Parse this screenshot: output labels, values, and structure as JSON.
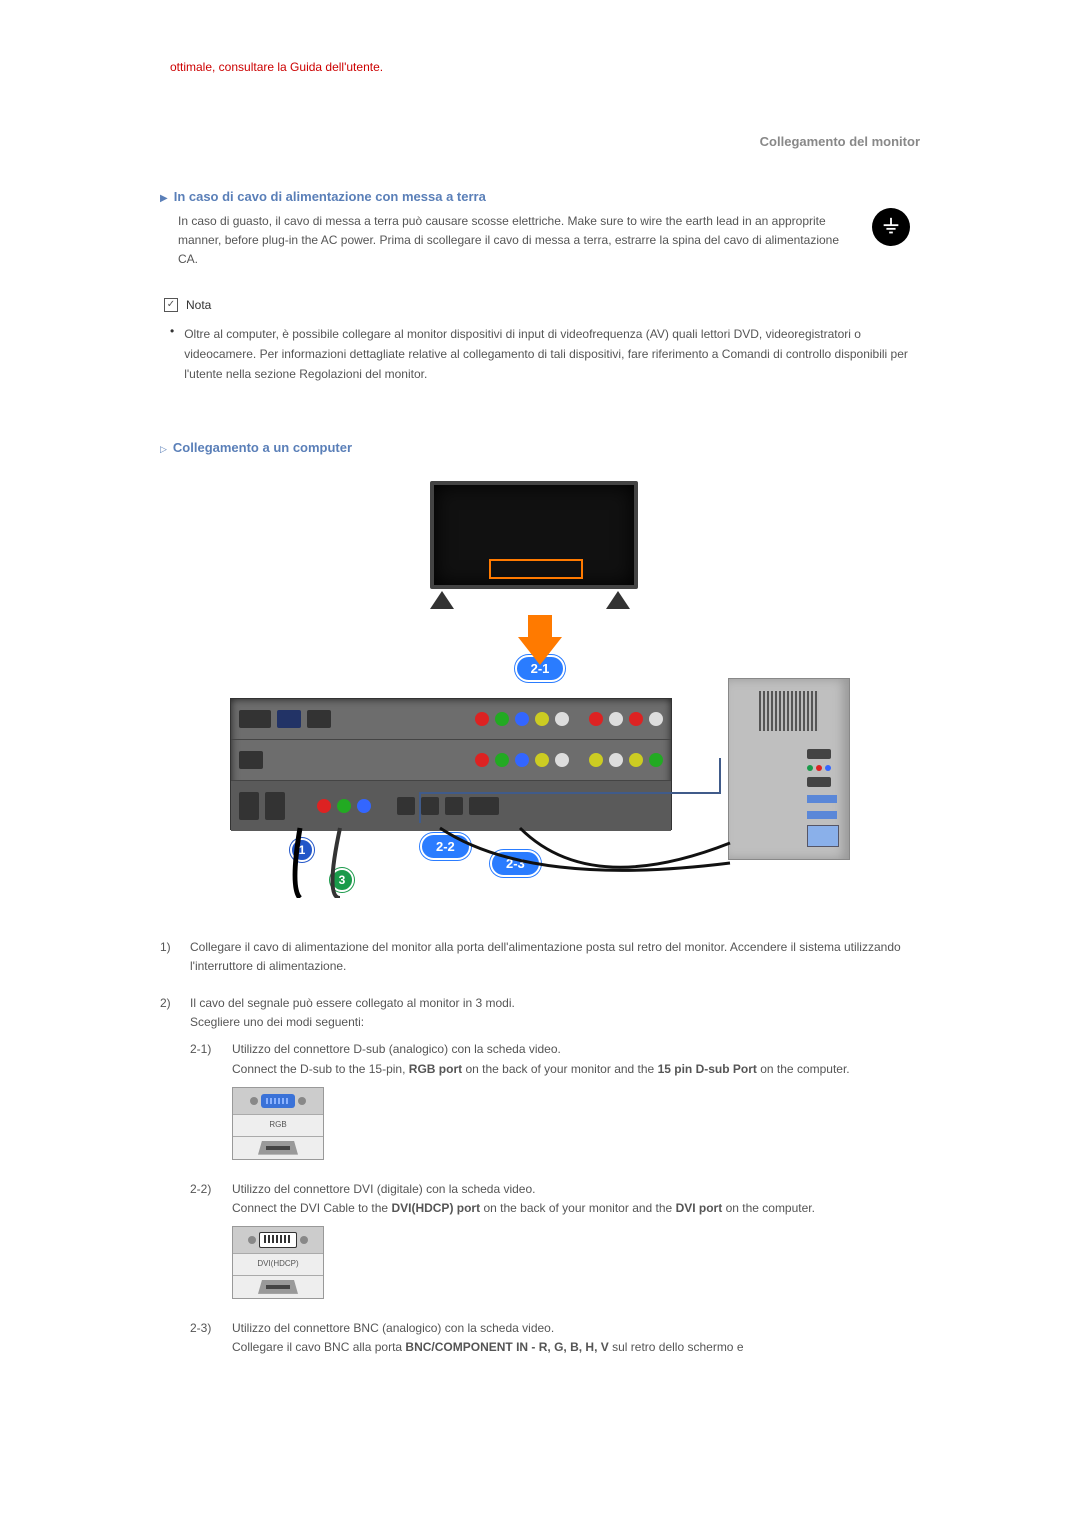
{
  "header": {
    "red_note": "ottimale, consultare la Guida dell'utente.",
    "section_title": "Collegamento del monitor"
  },
  "grounding": {
    "heading": "In caso di cavo di alimentazione con messa a terra",
    "text": "In caso di guasto, il cavo di messa a terra può causare scosse elettriche. Make sure to wire the earth lead in an approprite manner, before plug-in the AC power. Prima di scollegare il cavo di messa a terra, estrarre la spina del cavo di alimentazione CA."
  },
  "nota": {
    "label": "Nota",
    "text": "Oltre al computer, è possibile collegare al monitor dispositivi di input di videofrequenza (AV) quali lettori DVD, videoregistratori o videocamere. Per informazioni dettagliate relative al collegamento di tali dispositivi, fare riferimento a Comandi di controllo disponibili per l'utente nella sezione Regolazioni del monitor."
  },
  "connecting": {
    "heading": "Collegamento a un computer"
  },
  "diagram": {
    "callout_2_1": "2-1",
    "callout_2_2": "2-2",
    "callout_2_3": "2-3",
    "badge_1": "1",
    "badge_3": "3"
  },
  "steps": {
    "s1": {
      "num": "1)",
      "text": "Collegare il cavo di alimentazione del monitor alla porta dell'alimentazione posta sul retro del monitor. Accendere il sistema utilizzando l'interruttore di alimentazione."
    },
    "s2": {
      "num": "2)",
      "intro": "Il cavo del segnale può essere collegato al monitor in 3 modi.",
      "subline": "Scegliere uno dei modi seguenti:",
      "s21": {
        "num": "2-1)",
        "line1": "Utilizzo del connettore D-sub (analogico) con la scheda video.",
        "line2_a": "Connect the D-sub to the 15-pin, ",
        "line2_b": "RGB port",
        "line2_c": " on the back of your monitor and the ",
        "line2_d": "15 pin D-sub Port",
        "line2_e": " on the computer.",
        "port_label": "RGB"
      },
      "s22": {
        "num": "2-2)",
        "line1": "Utilizzo del connettore DVI (digitale) con la scheda video.",
        "line2_a": "Connect the DVI Cable to the ",
        "line2_b": "DVI(HDCP) port",
        "line2_c": " on the back of your monitor and the ",
        "line2_d": "DVI port",
        "line2_e": " on the computer.",
        "port_label": "DVI(HDCP)"
      },
      "s23": {
        "num": "2-3)",
        "line1": "Utilizzo del connettore BNC (analogico) con la scheda video.",
        "line2_a": "Collegare il cavo BNC alla porta ",
        "line2_b": "BNC/COMPONENT IN - R, G, B, H, V",
        "line2_c": " sul retro dello schermo e"
      }
    }
  }
}
